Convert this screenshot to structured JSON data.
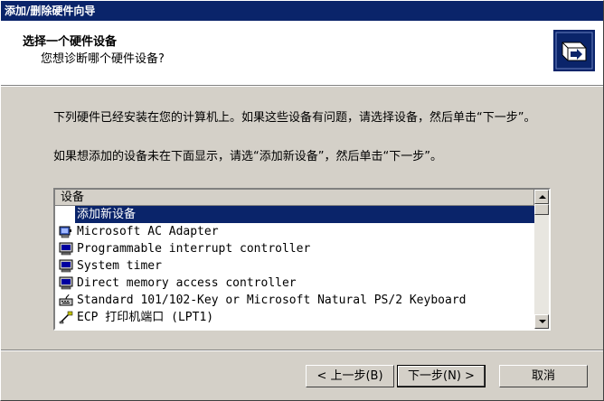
{
  "window": {
    "title": "添加/删除硬件向导"
  },
  "header": {
    "title": "选择一个硬件设备",
    "subtitle": "您想诊断哪个硬件设备?"
  },
  "instructions": {
    "line1": "下列硬件已经安装在您的计算机上。如果这些设备有问题，请选择设备，然后单击“下一步”。",
    "line2": "如果想添加的设备未在下面显示，请选“添加新设备”，然后单击“下一步”。"
  },
  "device_list": {
    "column_header": "设备",
    "items": [
      {
        "label": "添加新设备",
        "icon": "none",
        "selected": true
      },
      {
        "label": "Microsoft AC Adapter",
        "icon": "battery-icon"
      },
      {
        "label": "Programmable interrupt controller",
        "icon": "computer-icon"
      },
      {
        "label": "System timer",
        "icon": "computer-icon"
      },
      {
        "label": "Direct memory access controller",
        "icon": "computer-icon"
      },
      {
        "label": "Standard 101/102-Key or Microsoft Natural PS/2 Keyboard",
        "icon": "keyboard-icon"
      },
      {
        "label": "ECP 打印机端口 (LPT1)",
        "icon": "printer-port-icon"
      }
    ]
  },
  "buttons": {
    "back": "< 上一步(B)",
    "next": "下一步(N) >",
    "cancel": "取消"
  },
  "colors": {
    "titlebar": "#0a246a",
    "face": "#d4d0c8",
    "selection": "#0a246a"
  }
}
